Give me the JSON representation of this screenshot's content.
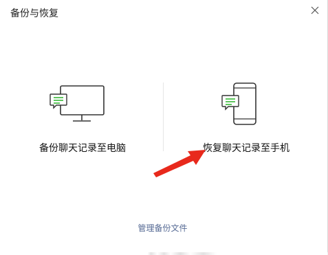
{
  "window": {
    "title": "备份与恢复"
  },
  "options": {
    "backup_to_pc": {
      "label": "备份聊天记录至电脑",
      "icon": "monitor-chat-icon"
    },
    "restore_to_phone": {
      "label": "恢复聊天记录至手机",
      "icon": "phone-chat-icon"
    }
  },
  "footer": {
    "manage_label": "管理备份文件"
  },
  "colors": {
    "accent_green": "#1aad19",
    "link_blue": "#576b95",
    "arrow_red": "#e8291c"
  },
  "icons": {
    "close": "close-icon",
    "annotation_arrow": "red-arrow-icon"
  }
}
